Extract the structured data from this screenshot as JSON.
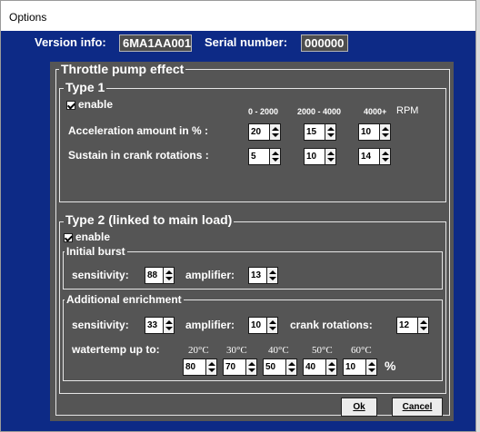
{
  "window": {
    "title": "Options"
  },
  "info": {
    "version_label": "Version info:",
    "version_value": "6MA1AA001",
    "serial_label": "Serial number:",
    "serial_value": "000000"
  },
  "throttle": {
    "title": "Throttle pump effect",
    "type1": {
      "title": "Type 1",
      "enable_label": "enable",
      "col_headers": [
        "0 - 2000",
        "2000 - 4000",
        "4000+"
      ],
      "rpm_label": "RPM",
      "accel_label": "Acceleration amount in % :",
      "accel_values": [
        "20",
        "15",
        "10"
      ],
      "sustain_label": "Sustain in crank rotations :",
      "sustain_values": [
        "5",
        "10",
        "14"
      ]
    },
    "type2": {
      "title": "Type 2 (linked to main load)",
      "enable_label": "enable",
      "burst": {
        "title": "Initial burst",
        "sensitivity_label": "sensitivity:",
        "sensitivity_value": "88",
        "amplifier_label": "amplifier:",
        "amplifier_value": "13"
      },
      "enrich": {
        "title": "Additional enrichment",
        "sensitivity_label": "sensitivity:",
        "sensitivity_value": "33",
        "amplifier_label": "amplifier:",
        "amplifier_value": "10",
        "crank_label": "crank rotations:",
        "crank_value": "12",
        "watertemp_label": "watertemp up to:",
        "temps": [
          "20°C",
          "30°C",
          "40°C",
          "50°C",
          "60°C"
        ],
        "temp_values": [
          "80",
          "70",
          "50",
          "40",
          "10"
        ],
        "percent_label": "%"
      }
    }
  },
  "buttons": {
    "ok_label": "Ok",
    "cancel_label": "Cancel"
  }
}
